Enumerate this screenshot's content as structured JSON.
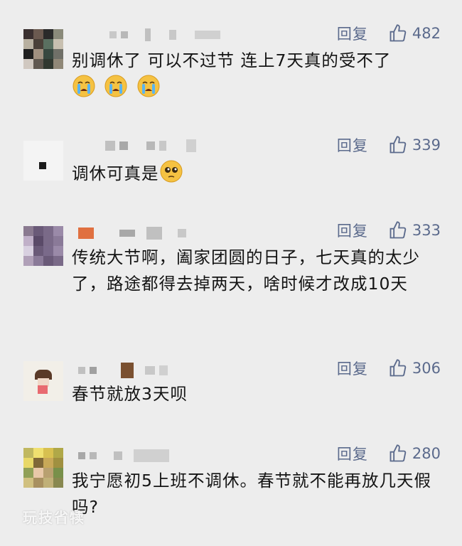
{
  "comments": [
    {
      "reply_label": "回复",
      "likes": "482",
      "text": "别调休了 可以不过节 连上7天真的受不了",
      "emoji": [
        "crying-face",
        "crying-face",
        "crying-face"
      ]
    },
    {
      "reply_label": "回复",
      "likes": "339",
      "text": "调休可真是",
      "emoji": [
        "pleading-face"
      ]
    },
    {
      "reply_label": "回复",
      "likes": "333",
      "text": "传统大节啊，阖家团圆的日子，七天真的太少了，路途都得去掉两天，啥时候才改成10天",
      "emoji": []
    },
    {
      "reply_label": "回复",
      "likes": "306",
      "text": "春节就放3天呗",
      "emoji": []
    },
    {
      "reply_label": "回复",
      "likes": "280",
      "text": "我宁愿初5上班不调休。春节就不能再放几天假吗?",
      "emoji": []
    }
  ],
  "colors": {
    "action": "#5b6a8c",
    "background": "#ededed",
    "text": "#141414"
  },
  "watermark": "玩技省犊"
}
